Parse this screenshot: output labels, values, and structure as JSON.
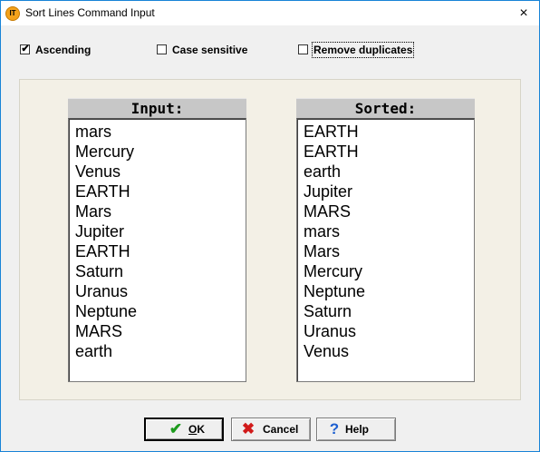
{
  "window": {
    "title": "Sort Lines Command Input",
    "icon_text": "IT"
  },
  "options": [
    {
      "label": "Ascending",
      "checked": true
    },
    {
      "label": "Case sensitive",
      "checked": false
    },
    {
      "label": "Remove duplicates",
      "checked": false
    }
  ],
  "input_list": {
    "header": "Input:",
    "items": [
      "mars",
      "Mercury",
      "Venus",
      "EARTH",
      "Mars",
      "Jupiter",
      "EARTH",
      "Saturn",
      "Uranus",
      "Neptune",
      "MARS",
      "earth"
    ]
  },
  "sorted_list": {
    "header": "Sorted:",
    "items": [
      "EARTH",
      "EARTH",
      "earth",
      "Jupiter",
      "MARS",
      "mars",
      "Mars",
      "Mercury",
      "Neptune",
      "Saturn",
      "Uranus",
      "Venus"
    ]
  },
  "buttons": {
    "ok": {
      "label_underlined": "O",
      "label_rest": "K"
    },
    "cancel": {
      "label": "Cancel"
    },
    "help": {
      "label": "Help"
    }
  },
  "icons": {
    "close": "×",
    "check": "✔",
    "ok": "✔",
    "cancel": "✖",
    "help": "?"
  }
}
